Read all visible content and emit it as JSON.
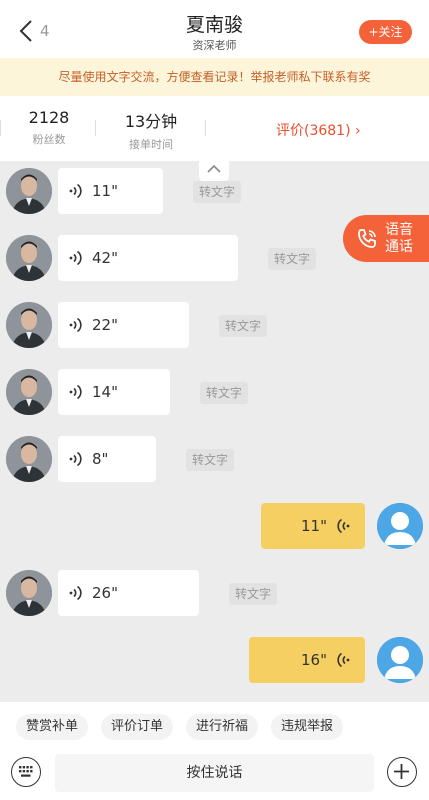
{
  "header": {
    "back_count": "4",
    "title": "夏南骏",
    "subtitle": "资深老师",
    "follow_label": "+关注"
  },
  "notice": "尽量使用文字交流，方便查看记录！举报老师私下联系有奖",
  "stats": {
    "fans_value": "2128",
    "fans_label": "粉丝数",
    "response_value": "13分钟",
    "response_label": "接单时间",
    "rating_label": "评价(3681)"
  },
  "voice_call": {
    "line1": "语音",
    "line2": "通话"
  },
  "messages": [
    {
      "side": "in",
      "duration": "11\"",
      "convert": "转文字"
    },
    {
      "side": "in",
      "duration": "42\"",
      "convert": "转文字"
    },
    {
      "side": "in",
      "duration": "22\"",
      "convert": "转文字"
    },
    {
      "side": "in",
      "duration": "14\"",
      "convert": "转文字"
    },
    {
      "side": "in",
      "duration": "8\"",
      "convert": "转文字"
    },
    {
      "side": "out",
      "duration": "11\""
    },
    {
      "side": "in",
      "duration": "26\"",
      "convert": "转文字"
    },
    {
      "side": "out",
      "duration": "16\""
    }
  ],
  "quick_actions": [
    "赞赏补单",
    "评价订单",
    "进行祈福",
    "违规举报"
  ],
  "input": {
    "talk_label": "按住说话"
  },
  "colors": {
    "accent": "#f4623a",
    "notice_bg": "#fdf5d9",
    "out_bubble": "#f6cf63"
  }
}
